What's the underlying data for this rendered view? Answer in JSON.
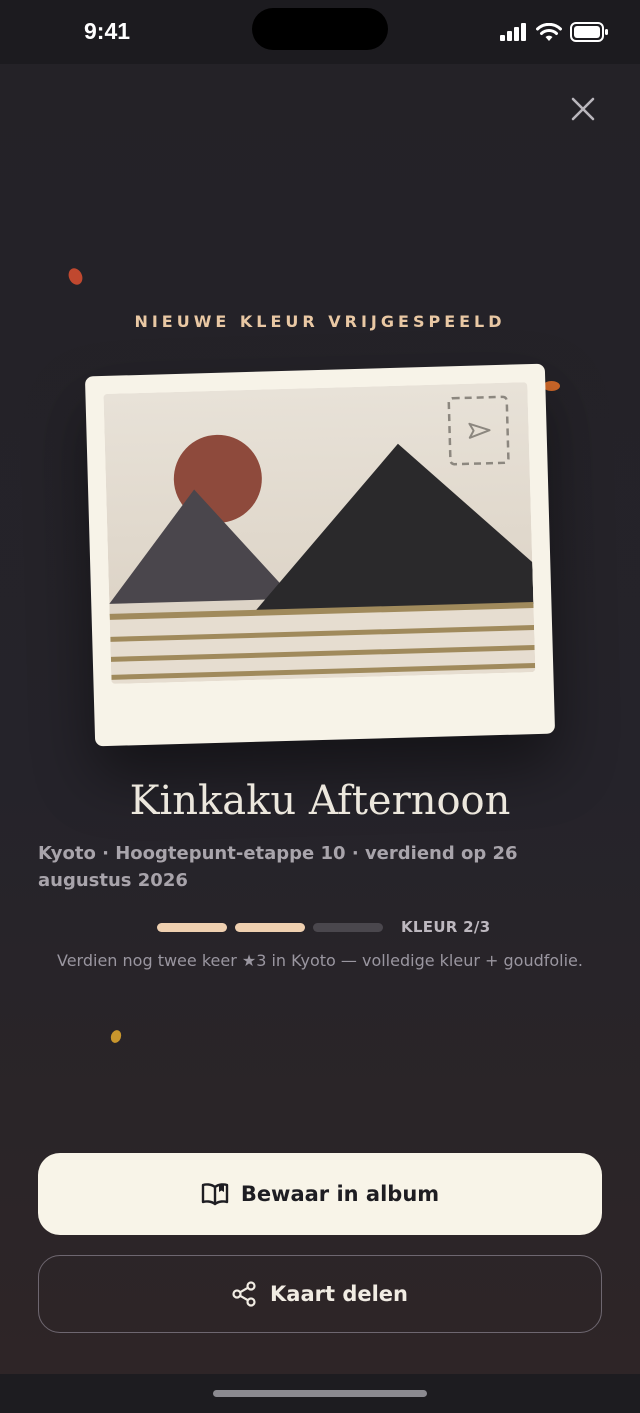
{
  "status_bar": {
    "time": "9:41",
    "icons": [
      "signal-icon",
      "wifi-icon",
      "battery-icon"
    ]
  },
  "sheet": {
    "close_icon": "close-icon",
    "eyebrow": "NIEUWE KLEUR VRIJGESPEELD",
    "card": {
      "stamp_icon": "paper-plane-icon",
      "colors": {
        "sun": "#8e4a3c",
        "mountain_left": "#4a464c",
        "mountain_right": "#2a292b",
        "stripes": "#a08a5c",
        "sky_top": "#e8e2d8",
        "sky_bottom": "#d9cfc1"
      }
    },
    "title": "Kinkaku Afternoon",
    "meta": "Kyoto · Hoogtepunt-etappe 10 · verdiend op 26 augustus 2026",
    "progress": {
      "label": "KLEUR 2/3",
      "current": 2,
      "total": 3,
      "filled_color": "#efd0b0",
      "empty_color": "#4a474d"
    },
    "hint": "Verdien nog twee keer ★3 in Kyoto — volledige kleur + goudfolie."
  },
  "actions": {
    "primary": {
      "label": "Bewaar in album",
      "icon": "book-open-icon"
    },
    "secondary": {
      "label": "Kaart delen",
      "icon": "share-icon"
    }
  },
  "colors": {
    "accent": "#e9c8a4",
    "confetti": [
      "#c0482f",
      "#d36a2a",
      "#c9962d"
    ]
  }
}
